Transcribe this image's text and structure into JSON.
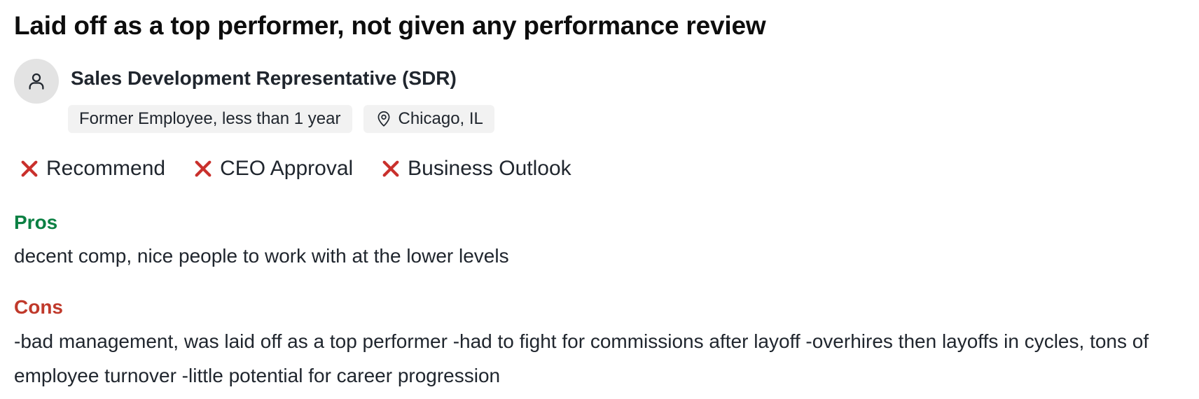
{
  "review": {
    "title": "Laid off as a top performer, not given any performance review",
    "job_title": "Sales Development Representative (SDR)",
    "employment_status": "Former Employee, less than 1 year",
    "location": "Chicago, IL",
    "avatar_icon": "person-icon",
    "location_icon": "map-pin-icon",
    "ratings": [
      {
        "label": "Recommend",
        "status": "negative",
        "icon": "x-icon"
      },
      {
        "label": "CEO Approval",
        "status": "negative",
        "icon": "x-icon"
      },
      {
        "label": "Business Outlook",
        "status": "negative",
        "icon": "x-icon"
      }
    ],
    "pros_label": "Pros",
    "pros_text": "decent comp, nice people to work with at the lower levels",
    "cons_label": "Cons",
    "cons_text": "-bad management, was laid off as a top performer -had to fight for commissions after layoff -overhires then layoffs in cycles, tons of employee turnover -little potential for career progression"
  },
  "colors": {
    "pros": "#0b8043",
    "cons": "#c0392b",
    "negative_icon": "#c9302c",
    "chip_bg": "#f2f2f2",
    "avatar_bg": "#e3e3e3"
  }
}
